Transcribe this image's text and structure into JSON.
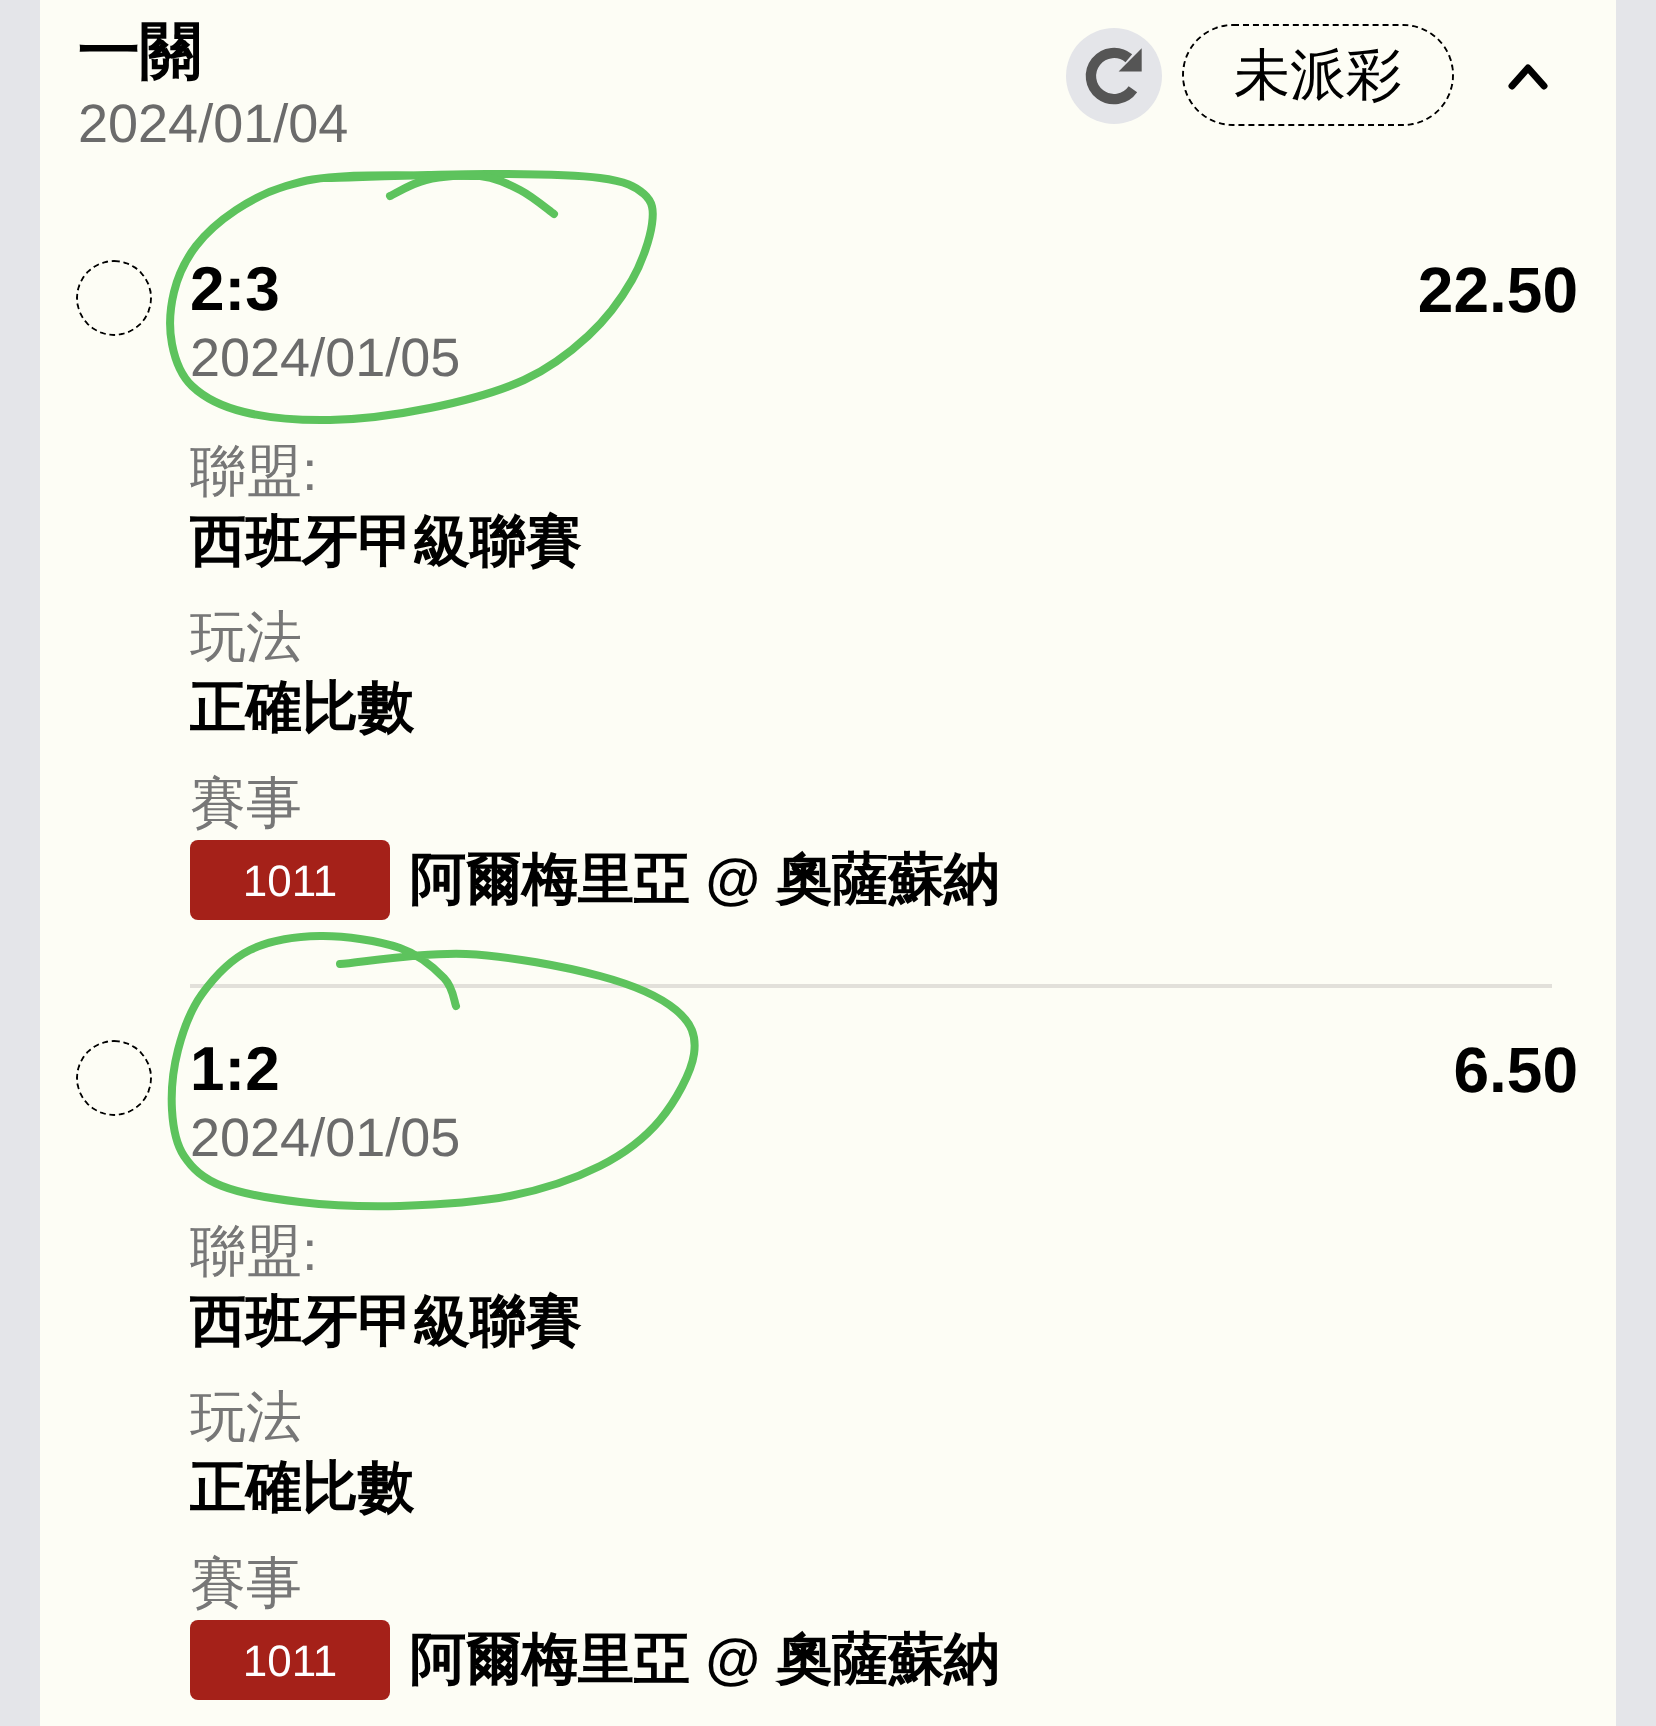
{
  "bet": {
    "title": "一關",
    "date": "2024/01/04",
    "status": "未派彩",
    "expanded": true
  },
  "selections": [
    {
      "checked": false,
      "score": "2:3",
      "date": "2024/01/05",
      "odds": "22.50",
      "fields": [
        {
          "kind": "text",
          "label": "聯盟:",
          "value": "西班牙甲級聯賽"
        },
        {
          "kind": "text",
          "label": "玩法",
          "value": "正確比數"
        },
        {
          "kind": "match",
          "label": "賽事",
          "code": "1011",
          "value": "阿爾梅里亞 @ 奧薩蘇納"
        }
      ]
    },
    {
      "checked": false,
      "score": "1:2",
      "date": "2024/01/05",
      "odds": "6.50",
      "fields": [
        {
          "kind": "text",
          "label": "聯盟:",
          "value": "西班牙甲級聯賽"
        },
        {
          "kind": "text",
          "label": "玩法",
          "value": "正確比數"
        },
        {
          "kind": "match",
          "label": "賽事",
          "code": "1011",
          "value": "阿爾梅里亞 @ 奧薩蘇納"
        }
      ]
    }
  ]
}
